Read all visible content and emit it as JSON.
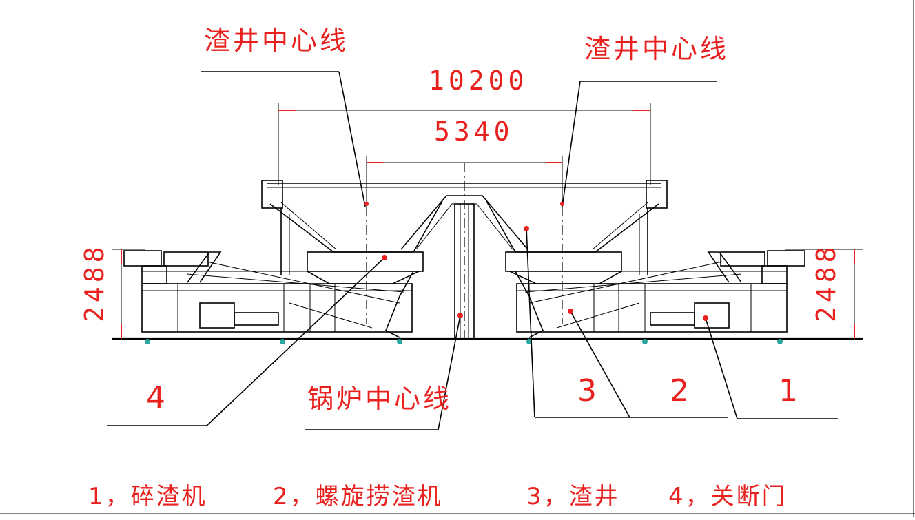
{
  "labels": {
    "slag_well_center_left": "渣井中心线",
    "slag_well_center_right": "渣井中心线",
    "boiler_center": "锅炉中心线"
  },
  "dimensions": {
    "overall_width": "10200",
    "well_spacing": "5340",
    "height_left": "2488",
    "height_right": "2488"
  },
  "callouts": {
    "left_4": "4",
    "right_3": "3",
    "right_2": "2",
    "right_1": "1"
  },
  "legend": {
    "item1": "1，碎渣机",
    "item2": "2，螺旋捞渣机",
    "item3": "3，渣井",
    "item4": "4，关断门"
  },
  "colors": {
    "annotation": "#e8201e",
    "lines": "#000000",
    "feet": "#2aa7a0"
  }
}
